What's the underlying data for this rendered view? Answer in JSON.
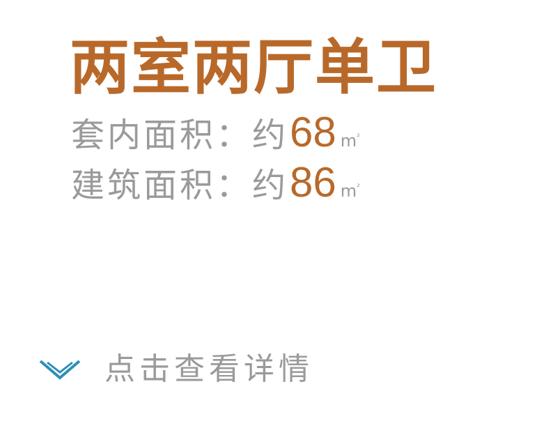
{
  "title": "两室两厅单卫",
  "areas": [
    {
      "label": "套内面积：约",
      "value": "68",
      "unit": "m",
      "unit_sup": "²"
    },
    {
      "label": "建筑面积：约",
      "value": "86",
      "unit": "m",
      "unit_sup": "²"
    }
  ],
  "details_link": {
    "label": "点击查看详情",
    "icon": "chevron-down-icon"
  },
  "colors": {
    "accent": "#b8692a",
    "text_gray": "#9a9a9a",
    "icon_blue": "#2c8fb8"
  }
}
